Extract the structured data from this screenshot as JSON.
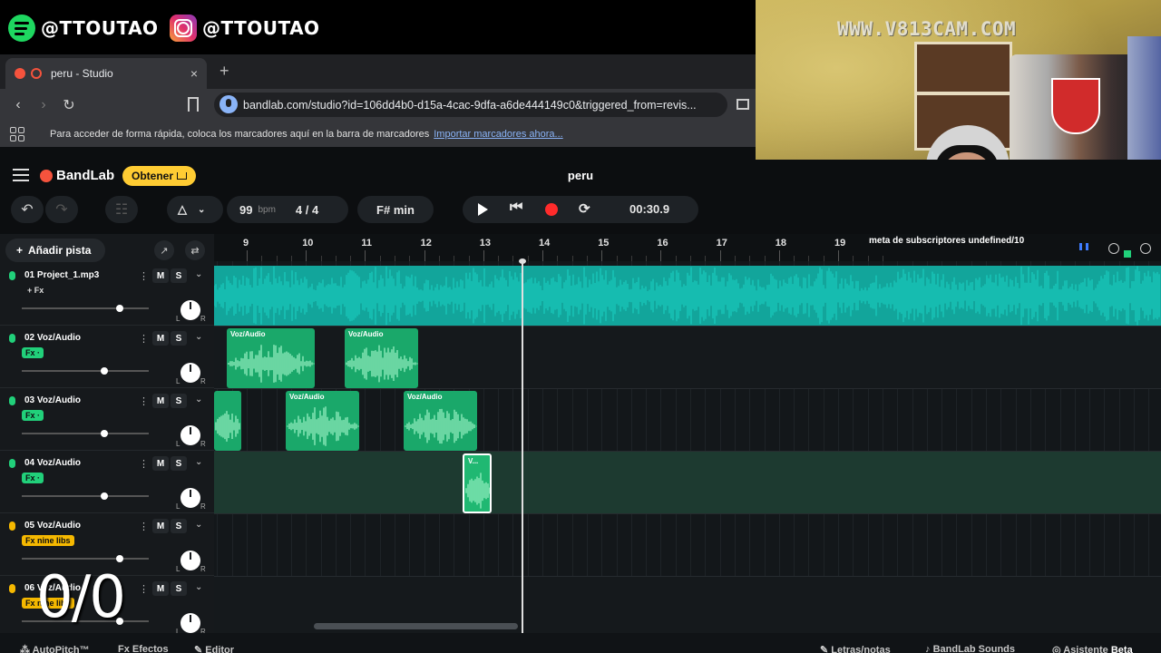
{
  "overlay": {
    "spotify_handle": "@TTOUTAO",
    "instagram_handle": "@TTOUTAO",
    "cam_watermark": "WWW.V813CAM.COM",
    "counter": "0/0",
    "meta_text": "meta de subscriptores undefined/10"
  },
  "browser": {
    "tab_title": "peru - Studio",
    "tab_close": "×",
    "new_tab": "+",
    "url": "bandlab.com/studio?id=106dd4b0-d15a-4cac-9dfa-a6de444149c0&triggered_from=revis...",
    "bookmarks_hint": "Para acceder de forma rápida, coloca los marcadores aquí en la barra de marcadores",
    "bookmarks_link": "Importar marcadores ahora..."
  },
  "studio": {
    "logo": "BandLab",
    "get_button": "Obtener",
    "project_title": "peru",
    "bpm": "99",
    "bpm_unit": "bpm",
    "time_signature": "4 / 4",
    "key": "F# min",
    "timecode": "00:30.9",
    "add_track": "Añadir pista",
    "ruler": [
      "9",
      "10",
      "11",
      "12",
      "13",
      "14",
      "15",
      "16",
      "17",
      "18",
      "19"
    ],
    "tracks": [
      {
        "name": "01  Project_1.mp3",
        "fx": "+ Fx",
        "fx_style": "plain",
        "mic": "green",
        "volume": 0.77
      },
      {
        "name": "02  Voz/Audio",
        "fx": "Fx  ·",
        "fx_style": "green",
        "mic": "green",
        "volume": 0.65
      },
      {
        "name": "03  Voz/Audio",
        "fx": "Fx  ·",
        "fx_style": "green",
        "mic": "green",
        "volume": 0.65
      },
      {
        "name": "04  Voz/Audio",
        "fx": "Fx  ·",
        "fx_style": "green",
        "mic": "green",
        "volume": 0.65
      },
      {
        "name": "05  Voz/Audio",
        "fx": "Fx  nine libs",
        "fx_style": "yellow",
        "mic": "yellow",
        "volume": 0.77
      },
      {
        "name": "06  Voz/Audio",
        "fx": "Fx  nine libs",
        "fx_style": "yellow",
        "mic": "yellow",
        "volume": 0.77
      }
    ],
    "mute_label": "M",
    "solo_label": "S",
    "pan_left": "L",
    "pan_right": "R",
    "clips": [
      {
        "track": 1,
        "label": "Voz/Audio"
      },
      {
        "track": 1,
        "label": "Voz/Audio"
      },
      {
        "track": 2,
        "label": ""
      },
      {
        "track": 2,
        "label": "Voz/Audio"
      },
      {
        "track": 2,
        "label": "Voz/Audio"
      },
      {
        "track": 3,
        "label": "V..."
      }
    ],
    "bottom": {
      "autopitch": "AutoPitch™",
      "effects": "Efectos",
      "editor": "Editor",
      "lyrics": "Letras/notas",
      "sounds": "BandLab Sounds",
      "assistant": "Asistente",
      "beta": "Beta"
    }
  },
  "colors": {
    "accent": "#21d07a",
    "master_wave": "#19c8bb",
    "clip": "#1aa86a",
    "record": "#ff2b2b",
    "get_button": "#ffcc33"
  }
}
